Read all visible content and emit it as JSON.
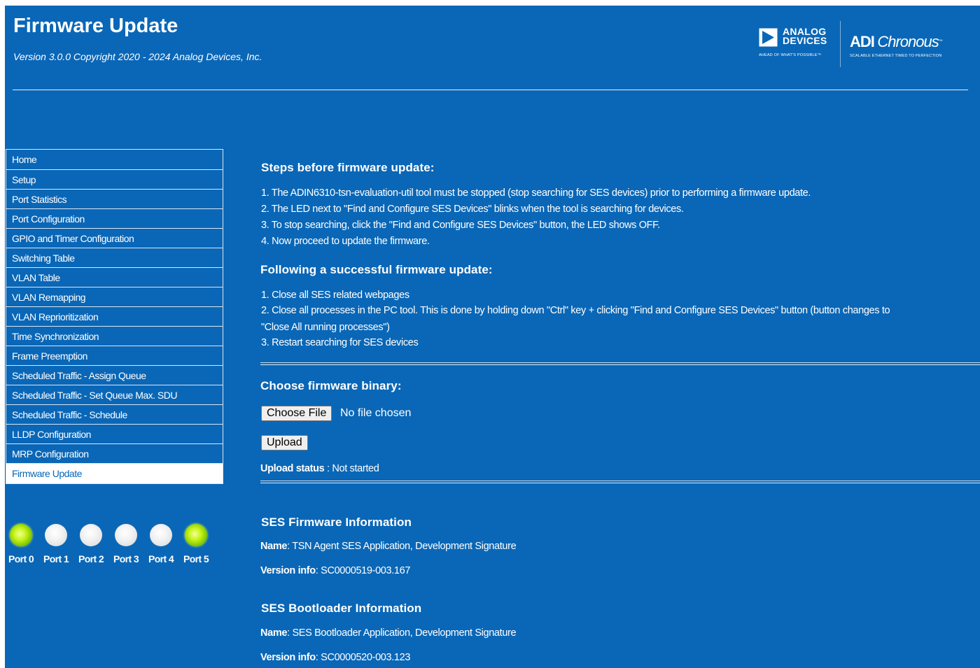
{
  "header": {
    "title": "Firmware Update",
    "version": "Version 3.0.0 Copyright 2020 - 2024 Analog Devices, Inc."
  },
  "logos": {
    "adi_line1": "ANALOG",
    "adi_line2": "DEVICES",
    "adi_tagline": "AHEAD OF WHAT'S POSSIBLE™",
    "chronous_adi": "ADI",
    "chronous_name": "Chronous",
    "chronous_tm": "™",
    "chronous_tagline": "SCALABLE ETHERNET TIMED TO PERFECTION"
  },
  "sidebar": {
    "items": [
      {
        "label": "Home"
      },
      {
        "label": "Setup"
      },
      {
        "label": "Port Statistics"
      },
      {
        "label": "Port Configuration"
      },
      {
        "label": "GPIO and Timer Configuration"
      },
      {
        "label": "Switching Table"
      },
      {
        "label": "VLAN Table"
      },
      {
        "label": "VLAN Remapping"
      },
      {
        "label": "VLAN Reprioritization"
      },
      {
        "label": "Time Synchronization"
      },
      {
        "label": "Frame Preemption"
      },
      {
        "label": "Scheduled Traffic - Assign Queue"
      },
      {
        "label": "Scheduled Traffic - Set Queue Max. SDU"
      },
      {
        "label": "Scheduled Traffic - Schedule"
      },
      {
        "label": "LLDP Configuration"
      },
      {
        "label": "MRP Configuration"
      },
      {
        "label": "Firmware Update",
        "active": true
      }
    ]
  },
  "ports": [
    {
      "label": "Port 0",
      "state": "on"
    },
    {
      "label": "Port 1",
      "state": "off"
    },
    {
      "label": "Port 2",
      "state": "off"
    },
    {
      "label": "Port 3",
      "state": "off"
    },
    {
      "label": "Port 4",
      "state": "off"
    },
    {
      "label": "Port 5",
      "state": "on"
    }
  ],
  "steps_before": {
    "heading": "Steps before firmware update:",
    "items": [
      "1. The ADIN6310-tsn-evaluation-util tool must be stopped (stop searching for SES devices) prior to performing a firmware update.",
      "2. The LED next to \"Find and Configure SES Devices\" blinks when the tool is searching for devices.",
      "3. To stop searching, click the \"Find and Configure SES Devices\" button, the LED shows OFF.",
      "4. Now proceed to update the firmware."
    ]
  },
  "steps_after": {
    "heading": "Following a successful firmware update:",
    "items": [
      "1. Close all SES related webpages",
      "2. Close all processes in the PC tool. This is done by holding down \"Ctrl\" key + clicking \"Find and Configure SES Devices\" button (button changes to",
      "\"Close All running processes\")",
      "3. Restart searching for SES devices"
    ]
  },
  "upload": {
    "heading": "Choose firmware binary:",
    "choose_label": "Choose File",
    "no_file": "No file chosen",
    "upload_label": "Upload",
    "status_label": "Upload status",
    "status_value": " : Not started"
  },
  "fw_info": {
    "heading": "SES Firmware Information",
    "name_label": "Name",
    "name_value": ": TSN Agent SES Application, Development Signature",
    "version_label": "Version info",
    "version_value": ": SC0000519-003.167"
  },
  "boot_info": {
    "heading": "SES Bootloader Information",
    "name_label": "Name",
    "name_value": ": SES Bootloader Application, Development Signature",
    "version_label": "Version info",
    "version_value": ": SC0000520-003.123"
  },
  "colors": {
    "background": "#0a67b7",
    "led_on": "#9be000",
    "led_off": "#e8e8e8",
    "active_nav_bg": "#ffffff",
    "active_nav_text": "#0a67b7"
  }
}
